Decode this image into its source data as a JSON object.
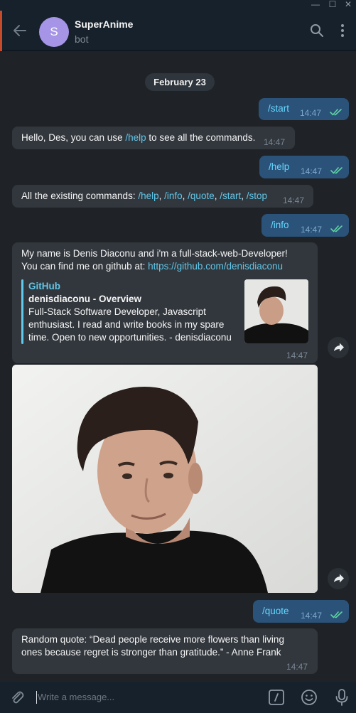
{
  "window": {
    "controls": [
      "—",
      "☐",
      "✕"
    ]
  },
  "header": {
    "title": "SuperAnime",
    "subtitle": "bot",
    "avatar_letter": "S"
  },
  "date_separator": "February 23",
  "messages": [
    {
      "direction": "out",
      "text": "/start",
      "time": "14:47"
    },
    {
      "direction": "in",
      "parts": [
        "Hello, Des, you can use ",
        "/help",
        " to see all the commands."
      ],
      "time": "14:47"
    },
    {
      "direction": "out",
      "text": "/help",
      "time": "14:47"
    },
    {
      "direction": "in",
      "parts": [
        "All the existing commands: ",
        "/help",
        ", ",
        "/info",
        ", ",
        "/quote",
        ", ",
        "/start",
        ", ",
        "/stop"
      ],
      "time": "14:47"
    },
    {
      "direction": "out",
      "text": "/info",
      "time": "14:47"
    },
    {
      "direction": "in",
      "line1": "My name is Denis Diaconu and i'm a full-stack-web-Developer!",
      "line2_prefix": "You can find me on github at: ",
      "line2_link": "https://github.com/denisdiaconu",
      "preview": {
        "site": "GitHub",
        "title": "denisdiaconu - Overview",
        "desc1": "Full-Stack Software Developer, Javascript",
        "desc2": "enthusiast. I read and write books in my spare",
        "desc3": "time. Open to new opportunities. - denisdiaconu"
      },
      "time": "14:47"
    },
    {
      "direction": "in",
      "type": "photo"
    },
    {
      "direction": "out",
      "text": "/quote",
      "time": "14:47"
    },
    {
      "direction": "in",
      "line1": "Random quote:  “Dead people receive more flowers than living",
      "line2": "ones because regret is stronger than gratitude.” - Anne Frank",
      "time": "14:47"
    }
  ],
  "composer": {
    "placeholder": "Write a message..."
  },
  "colors": {
    "outgoing": "#2b5278",
    "incoming": "#32373d",
    "accent": "#61c6e8",
    "avatar": "#a695e7"
  }
}
